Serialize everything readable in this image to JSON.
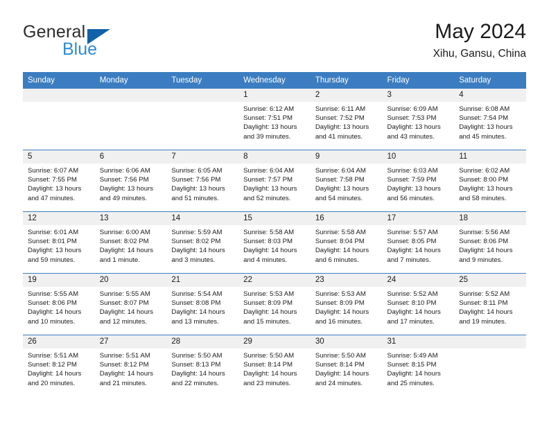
{
  "brand": {
    "word1": "General",
    "word2": "Blue",
    "logo_icon": "blue-triangle-icon",
    "accent_color": "#1162a8",
    "blue_text_color": "#2e8ad4"
  },
  "header": {
    "month_title": "May 2024",
    "location": "Xihu, Gansu, China"
  },
  "theme": {
    "header_row_bg": "#3b7dc0",
    "day_number_bg": "#f0f0f0",
    "row_separator": "#3b7dc0"
  },
  "weekdays": [
    "Sunday",
    "Monday",
    "Tuesday",
    "Wednesday",
    "Thursday",
    "Friday",
    "Saturday"
  ],
  "labels": {
    "sunrise": "Sunrise:",
    "sunset": "Sunset:",
    "daylight": "Daylight:"
  },
  "weeks": [
    [
      {
        "day": "",
        "sunrise": "",
        "sunset": "",
        "daylight_line1": "",
        "daylight_line2": ""
      },
      {
        "day": "",
        "sunrise": "",
        "sunset": "",
        "daylight_line1": "",
        "daylight_line2": ""
      },
      {
        "day": "",
        "sunrise": "",
        "sunset": "",
        "daylight_line1": "",
        "daylight_line2": ""
      },
      {
        "day": "1",
        "sunrise": "Sunrise: 6:12 AM",
        "sunset": "Sunset: 7:51 PM",
        "daylight_line1": "Daylight: 13 hours",
        "daylight_line2": "and 39 minutes."
      },
      {
        "day": "2",
        "sunrise": "Sunrise: 6:11 AM",
        "sunset": "Sunset: 7:52 PM",
        "daylight_line1": "Daylight: 13 hours",
        "daylight_line2": "and 41 minutes."
      },
      {
        "day": "3",
        "sunrise": "Sunrise: 6:09 AM",
        "sunset": "Sunset: 7:53 PM",
        "daylight_line1": "Daylight: 13 hours",
        "daylight_line2": "and 43 minutes."
      },
      {
        "day": "4",
        "sunrise": "Sunrise: 6:08 AM",
        "sunset": "Sunset: 7:54 PM",
        "daylight_line1": "Daylight: 13 hours",
        "daylight_line2": "and 45 minutes."
      }
    ],
    [
      {
        "day": "5",
        "sunrise": "Sunrise: 6:07 AM",
        "sunset": "Sunset: 7:55 PM",
        "daylight_line1": "Daylight: 13 hours",
        "daylight_line2": "and 47 minutes."
      },
      {
        "day": "6",
        "sunrise": "Sunrise: 6:06 AM",
        "sunset": "Sunset: 7:56 PM",
        "daylight_line1": "Daylight: 13 hours",
        "daylight_line2": "and 49 minutes."
      },
      {
        "day": "7",
        "sunrise": "Sunrise: 6:05 AM",
        "sunset": "Sunset: 7:56 PM",
        "daylight_line1": "Daylight: 13 hours",
        "daylight_line2": "and 51 minutes."
      },
      {
        "day": "8",
        "sunrise": "Sunrise: 6:04 AM",
        "sunset": "Sunset: 7:57 PM",
        "daylight_line1": "Daylight: 13 hours",
        "daylight_line2": "and 52 minutes."
      },
      {
        "day": "9",
        "sunrise": "Sunrise: 6:04 AM",
        "sunset": "Sunset: 7:58 PM",
        "daylight_line1": "Daylight: 13 hours",
        "daylight_line2": "and 54 minutes."
      },
      {
        "day": "10",
        "sunrise": "Sunrise: 6:03 AM",
        "sunset": "Sunset: 7:59 PM",
        "daylight_line1": "Daylight: 13 hours",
        "daylight_line2": "and 56 minutes."
      },
      {
        "day": "11",
        "sunrise": "Sunrise: 6:02 AM",
        "sunset": "Sunset: 8:00 PM",
        "daylight_line1": "Daylight: 13 hours",
        "daylight_line2": "and 58 minutes."
      }
    ],
    [
      {
        "day": "12",
        "sunrise": "Sunrise: 6:01 AM",
        "sunset": "Sunset: 8:01 PM",
        "daylight_line1": "Daylight: 13 hours",
        "daylight_line2": "and 59 minutes."
      },
      {
        "day": "13",
        "sunrise": "Sunrise: 6:00 AM",
        "sunset": "Sunset: 8:02 PM",
        "daylight_line1": "Daylight: 14 hours",
        "daylight_line2": "and 1 minute."
      },
      {
        "day": "14",
        "sunrise": "Sunrise: 5:59 AM",
        "sunset": "Sunset: 8:02 PM",
        "daylight_line1": "Daylight: 14 hours",
        "daylight_line2": "and 3 minutes."
      },
      {
        "day": "15",
        "sunrise": "Sunrise: 5:58 AM",
        "sunset": "Sunset: 8:03 PM",
        "daylight_line1": "Daylight: 14 hours",
        "daylight_line2": "and 4 minutes."
      },
      {
        "day": "16",
        "sunrise": "Sunrise: 5:58 AM",
        "sunset": "Sunset: 8:04 PM",
        "daylight_line1": "Daylight: 14 hours",
        "daylight_line2": "and 6 minutes."
      },
      {
        "day": "17",
        "sunrise": "Sunrise: 5:57 AM",
        "sunset": "Sunset: 8:05 PM",
        "daylight_line1": "Daylight: 14 hours",
        "daylight_line2": "and 7 minutes."
      },
      {
        "day": "18",
        "sunrise": "Sunrise: 5:56 AM",
        "sunset": "Sunset: 8:06 PM",
        "daylight_line1": "Daylight: 14 hours",
        "daylight_line2": "and 9 minutes."
      }
    ],
    [
      {
        "day": "19",
        "sunrise": "Sunrise: 5:55 AM",
        "sunset": "Sunset: 8:06 PM",
        "daylight_line1": "Daylight: 14 hours",
        "daylight_line2": "and 10 minutes."
      },
      {
        "day": "20",
        "sunrise": "Sunrise: 5:55 AM",
        "sunset": "Sunset: 8:07 PM",
        "daylight_line1": "Daylight: 14 hours",
        "daylight_line2": "and 12 minutes."
      },
      {
        "day": "21",
        "sunrise": "Sunrise: 5:54 AM",
        "sunset": "Sunset: 8:08 PM",
        "daylight_line1": "Daylight: 14 hours",
        "daylight_line2": "and 13 minutes."
      },
      {
        "day": "22",
        "sunrise": "Sunrise: 5:53 AM",
        "sunset": "Sunset: 8:09 PM",
        "daylight_line1": "Daylight: 14 hours",
        "daylight_line2": "and 15 minutes."
      },
      {
        "day": "23",
        "sunrise": "Sunrise: 5:53 AM",
        "sunset": "Sunset: 8:09 PM",
        "daylight_line1": "Daylight: 14 hours",
        "daylight_line2": "and 16 minutes."
      },
      {
        "day": "24",
        "sunrise": "Sunrise: 5:52 AM",
        "sunset": "Sunset: 8:10 PM",
        "daylight_line1": "Daylight: 14 hours",
        "daylight_line2": "and 17 minutes."
      },
      {
        "day": "25",
        "sunrise": "Sunrise: 5:52 AM",
        "sunset": "Sunset: 8:11 PM",
        "daylight_line1": "Daylight: 14 hours",
        "daylight_line2": "and 19 minutes."
      }
    ],
    [
      {
        "day": "26",
        "sunrise": "Sunrise: 5:51 AM",
        "sunset": "Sunset: 8:12 PM",
        "daylight_line1": "Daylight: 14 hours",
        "daylight_line2": "and 20 minutes."
      },
      {
        "day": "27",
        "sunrise": "Sunrise: 5:51 AM",
        "sunset": "Sunset: 8:12 PM",
        "daylight_line1": "Daylight: 14 hours",
        "daylight_line2": "and 21 minutes."
      },
      {
        "day": "28",
        "sunrise": "Sunrise: 5:50 AM",
        "sunset": "Sunset: 8:13 PM",
        "daylight_line1": "Daylight: 14 hours",
        "daylight_line2": "and 22 minutes."
      },
      {
        "day": "29",
        "sunrise": "Sunrise: 5:50 AM",
        "sunset": "Sunset: 8:14 PM",
        "daylight_line1": "Daylight: 14 hours",
        "daylight_line2": "and 23 minutes."
      },
      {
        "day": "30",
        "sunrise": "Sunrise: 5:50 AM",
        "sunset": "Sunset: 8:14 PM",
        "daylight_line1": "Daylight: 14 hours",
        "daylight_line2": "and 24 minutes."
      },
      {
        "day": "31",
        "sunrise": "Sunrise: 5:49 AM",
        "sunset": "Sunset: 8:15 PM",
        "daylight_line1": "Daylight: 14 hours",
        "daylight_line2": "and 25 minutes."
      },
      {
        "day": "",
        "sunrise": "",
        "sunset": "",
        "daylight_line1": "",
        "daylight_line2": ""
      }
    ]
  ]
}
